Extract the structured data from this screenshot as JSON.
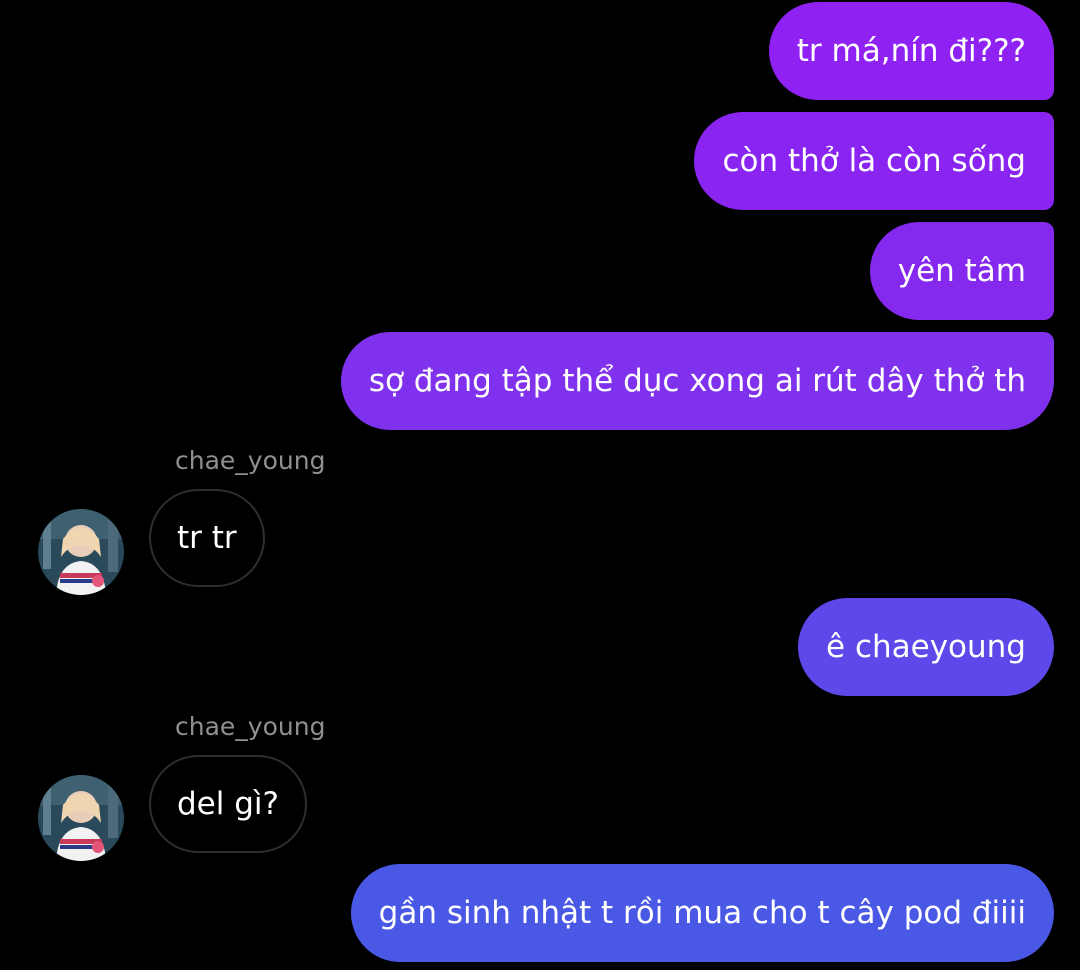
{
  "colors": {
    "background": "#000000",
    "incoming_border": "#2e2e2e",
    "sender_name": "#8f8f8f",
    "outgoing_gradient_top": "#8a22f2",
    "outgoing_gradient_bottom": "#4a5be6"
  },
  "messages": [
    {
      "direction": "out",
      "text": "tr má,nín đi???"
    },
    {
      "direction": "out",
      "text": "còn thở là còn sống"
    },
    {
      "direction": "out",
      "text": "yên tâm"
    },
    {
      "direction": "out",
      "text": "sợ đang tập thể dục xong ai rút dây thở th"
    },
    {
      "direction": "in",
      "sender": "chae_young",
      "avatar_icon": "user-avatar-icon",
      "text": "tr tr"
    },
    {
      "direction": "out",
      "text": "ê chaeyoung"
    },
    {
      "direction": "in",
      "sender": "chae_young",
      "avatar_icon": "user-avatar-icon",
      "text": "del gì?"
    },
    {
      "direction": "out",
      "text": "gần sinh nhật t rồi mua cho t cây pod điiii"
    }
  ]
}
